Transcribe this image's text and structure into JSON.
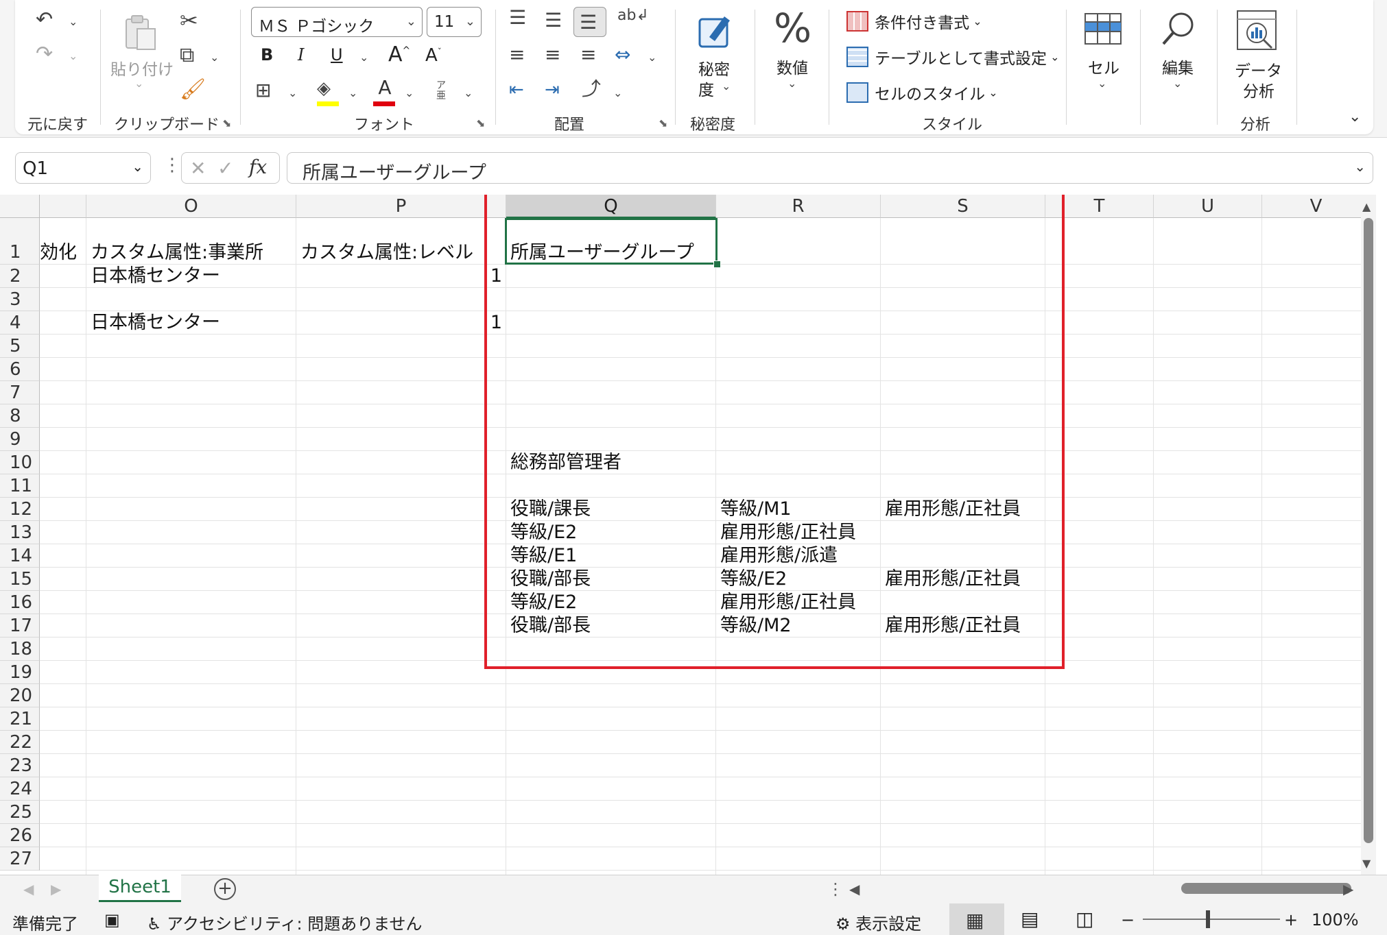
{
  "ribbon": {
    "undo_group": {
      "label": "元に戻す"
    },
    "clipboard": {
      "paste_label": "貼り付け",
      "label": "クリップボード"
    },
    "font": {
      "name": "ＭＳ Ｐゴシック",
      "size": "11",
      "label": "フォント",
      "phonetic_glyph": "ア亜"
    },
    "alignment": {
      "label": "配置"
    },
    "sensitivity": {
      "button_line1": "秘密",
      "button_line2": "度",
      "label": "秘密度"
    },
    "number": {
      "button": "数値"
    },
    "styles": {
      "conditional": "条件付き書式",
      "table": "テーブルとして書式設定",
      "cell_styles": "セルのスタイル",
      "label": "スタイル"
    },
    "cells": {
      "button": "セル"
    },
    "editing": {
      "button": "編集"
    },
    "analysis": {
      "button_line1": "データ",
      "button_line2": "分析",
      "label": "分析"
    }
  },
  "formula_bar": {
    "name_box": "Q1",
    "formula": "所属ユーザーグループ"
  },
  "columns": [
    {
      "label": "",
      "id": "N"
    },
    {
      "label": "O",
      "id": "O"
    },
    {
      "label": "P",
      "id": "P"
    },
    {
      "label": "Q",
      "id": "Q"
    },
    {
      "label": "R",
      "id": "R"
    },
    {
      "label": "S",
      "id": "S"
    },
    {
      "label": "T",
      "id": "T"
    },
    {
      "label": "U",
      "id": "U"
    },
    {
      "label": "V",
      "id": "V"
    }
  ],
  "rows": [
    "1",
    "2",
    "3",
    "4",
    "5",
    "6",
    "7",
    "8",
    "9",
    "10",
    "11",
    "12",
    "13",
    "14",
    "15",
    "16",
    "17",
    "18",
    "19",
    "20",
    "21",
    "22",
    "23",
    "24",
    "25",
    "26",
    "27"
  ],
  "cells": [
    {
      "ref": "N1",
      "value": "効化"
    },
    {
      "ref": "O1",
      "value": "カスタム属性:事業所"
    },
    {
      "ref": "P1",
      "value": "カスタム属性:レベル"
    },
    {
      "ref": "Q1",
      "value": "所属ユーザーグループ"
    },
    {
      "ref": "O2",
      "value": "日本橋センター"
    },
    {
      "ref": "P2",
      "value": "1"
    },
    {
      "ref": "O4",
      "value": "日本橋センター"
    },
    {
      "ref": "P4",
      "value": "1"
    },
    {
      "ref": "Q10",
      "value": "総務部管理者"
    },
    {
      "ref": "Q12",
      "value": "役職/課長"
    },
    {
      "ref": "R12",
      "value": "等級/M1"
    },
    {
      "ref": "S12",
      "value": "雇用形態/正社員"
    },
    {
      "ref": "Q13",
      "value": "等級/E2"
    },
    {
      "ref": "R13",
      "value": "雇用形態/正社員"
    },
    {
      "ref": "Q14",
      "value": "等級/E1"
    },
    {
      "ref": "R14",
      "value": "雇用形態/派遣"
    },
    {
      "ref": "Q15",
      "value": "役職/部長"
    },
    {
      "ref": "R15",
      "value": "等級/E2"
    },
    {
      "ref": "S15",
      "value": "雇用形態/正社員"
    },
    {
      "ref": "Q16",
      "value": "等級/E2"
    },
    {
      "ref": "R16",
      "value": "雇用形態/正社員"
    },
    {
      "ref": "Q17",
      "value": "役職/部長"
    },
    {
      "ref": "R17",
      "value": "等級/M2"
    },
    {
      "ref": "S17",
      "value": "雇用形態/正社員"
    }
  ],
  "sheet_tabs": [
    {
      "label": "Sheet1",
      "active": true
    }
  ],
  "status": {
    "ready": "準備完了",
    "accessibility": "アクセシビリティ: 問題ありません",
    "display_settings": "表示設定",
    "zoom": "100%"
  },
  "colors": {
    "accent": "#217346",
    "highlight_box": "#e0202a"
  }
}
